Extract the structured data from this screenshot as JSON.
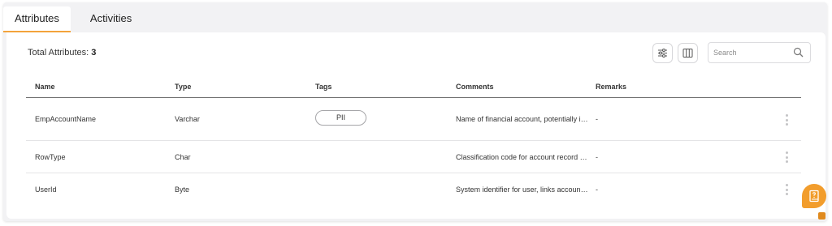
{
  "tabs": [
    {
      "label": "Attributes",
      "active": true
    },
    {
      "label": "Activities",
      "active": false
    }
  ],
  "summary": {
    "label": "Total Attributes:",
    "count": "3"
  },
  "toolbar": {
    "filter_icon": "sliders-icon",
    "columns_icon": "columns-icon"
  },
  "search": {
    "placeholder": "Search",
    "value": ""
  },
  "table": {
    "columns": [
      "Name",
      "Type",
      "Tags",
      "Comments",
      "Remarks"
    ],
    "rows": [
      {
        "name": "EmpAccountName",
        "type": "Varchar",
        "tag": "PII",
        "comment": "Name of financial account, potentially id...",
        "remarks": "-"
      },
      {
        "name": "RowType",
        "type": "Char",
        "tag": "",
        "comment": "Classification code for account record ty...",
        "remarks": "-"
      },
      {
        "name": "UserId",
        "type": "Byte",
        "tag": "",
        "comment": "System identifier for user, links accounts...",
        "remarks": "-"
      }
    ]
  },
  "colors": {
    "accent": "#f3a33b",
    "fab": "#f29d2c"
  }
}
